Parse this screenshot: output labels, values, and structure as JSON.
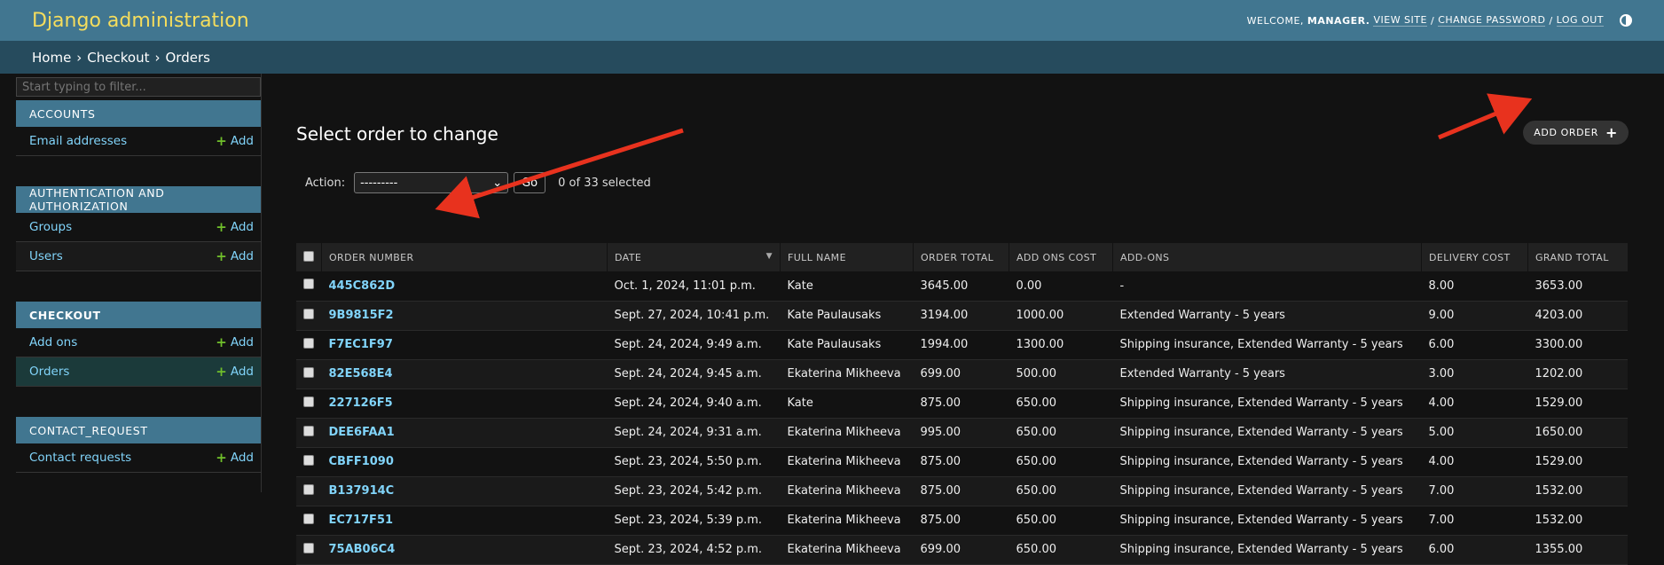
{
  "header": {
    "brand": "Django administration",
    "welcome": "WELCOME,",
    "user": "MANAGER.",
    "view_site": "VIEW SITE",
    "change_password": "CHANGE PASSWORD",
    "log_out": "LOG OUT",
    "sep": "/"
  },
  "breadcrumbs": {
    "home": "Home",
    "app": "Checkout",
    "current": "Orders",
    "sep": "›"
  },
  "sidebar": {
    "filter_placeholder": "Start typing to filter...",
    "add_label": "Add",
    "modules": [
      {
        "caption": "ACCOUNTS",
        "items": [
          "Email addresses"
        ]
      },
      {
        "caption": "AUTHENTICATION AND AUTHORIZATION",
        "items": [
          "Groups",
          "Users"
        ]
      },
      {
        "caption": "CHECKOUT",
        "items": [
          "Add ons",
          "Orders"
        ]
      },
      {
        "caption": "CONTACT_REQUEST",
        "items": [
          "Contact requests"
        ]
      }
    ]
  },
  "content": {
    "title": "Select order to change",
    "add_button": "ADD ORDER",
    "action_label": "Action:",
    "action_value": "---------",
    "go_label": "Go",
    "counter": "0 of 33 selected"
  },
  "table": {
    "columns": [
      "ORDER NUMBER",
      "DATE",
      "FULL NAME",
      "ORDER TOTAL",
      "ADD ONS COST",
      "ADD-ONS",
      "DELIVERY COST",
      "GRAND TOTAL"
    ],
    "rows": [
      [
        "445C862D",
        "Oct. 1, 2024, 11:01 p.m.",
        "Kate",
        "3645.00",
        "0.00",
        "-",
        "8.00",
        "3653.00"
      ],
      [
        "9B9815F2",
        "Sept. 27, 2024, 10:41 p.m.",
        "Kate Paulausaks",
        "3194.00",
        "1000.00",
        "Extended Warranty - 5 years",
        "9.00",
        "4203.00"
      ],
      [
        "F7EC1F97",
        "Sept. 24, 2024, 9:49 a.m.",
        "Kate Paulausaks",
        "1994.00",
        "1300.00",
        "Shipping insurance, Extended Warranty - 5 years",
        "6.00",
        "3300.00"
      ],
      [
        "82E568E4",
        "Sept. 24, 2024, 9:45 a.m.",
        "Ekaterina Mikheeva",
        "699.00",
        "500.00",
        "Extended Warranty - 5 years",
        "3.00",
        "1202.00"
      ],
      [
        "227126F5",
        "Sept. 24, 2024, 9:40 a.m.",
        "Kate",
        "875.00",
        "650.00",
        "Shipping insurance, Extended Warranty - 5 years",
        "4.00",
        "1529.00"
      ],
      [
        "DEE6FAA1",
        "Sept. 24, 2024, 9:31 a.m.",
        "Ekaterina Mikheeva",
        "995.00",
        "650.00",
        "Shipping insurance, Extended Warranty - 5 years",
        "5.00",
        "1650.00"
      ],
      [
        "CBFF1090",
        "Sept. 23, 2024, 5:50 p.m.",
        "Ekaterina Mikheeva",
        "875.00",
        "650.00",
        "Shipping insurance, Extended Warranty - 5 years",
        "4.00",
        "1529.00"
      ],
      [
        "B137914C",
        "Sept. 23, 2024, 5:42 p.m.",
        "Ekaterina Mikheeva",
        "875.00",
        "650.00",
        "Shipping insurance, Extended Warranty - 5 years",
        "7.00",
        "1532.00"
      ],
      [
        "EC717F51",
        "Sept. 23, 2024, 5:39 p.m.",
        "Ekaterina Mikheeva",
        "875.00",
        "650.00",
        "Shipping insurance, Extended Warranty - 5 years",
        "7.00",
        "1532.00"
      ],
      [
        "75AB06C4",
        "Sept. 23, 2024, 4:52 p.m.",
        "Ekaterina Mikheeva",
        "699.00",
        "650.00",
        "Shipping insurance, Extended Warranty - 5 years",
        "6.00",
        "1355.00"
      ]
    ]
  },
  "colors": {
    "header_bg": "#417690",
    "brand": "#f5dd5d",
    "breadcrumb_bg": "#264b5d",
    "link": "#81d4fa",
    "add_plus": "#70bf2b",
    "annotation_arrow": "#e8321e"
  }
}
